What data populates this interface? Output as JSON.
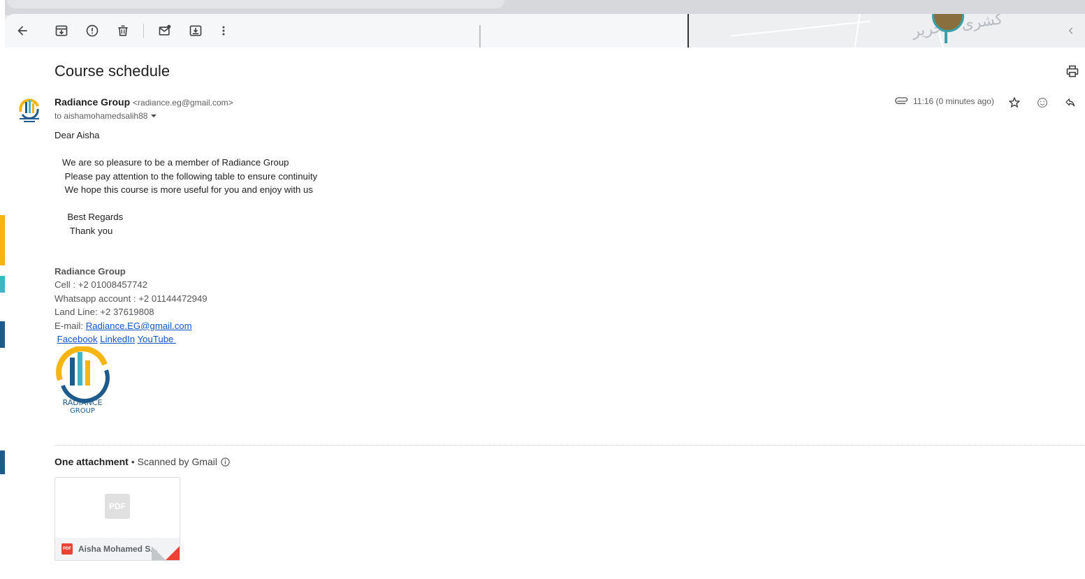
{
  "subject": "Course schedule",
  "sender": {
    "name": "Radiance Group",
    "email": "<radiance.eg@gmail.com>",
    "to": "to aishamohamedsalih88"
  },
  "meta": {
    "time": "11:16 (0 minutes ago)"
  },
  "body": {
    "greeting": "Dear Aisha",
    "line1": "   We are so pleasure to be a member of Radiance Group",
    "line2": "    Please pay attention to the following table to ensure continuity",
    "line3": "    We hope this course is more useful for you and enjoy with us",
    "closing1": "     Best Regards",
    "closing2": "      Thank you"
  },
  "signature": {
    "name": "Radiance Group",
    "cell": "Cell : +2 01008457742",
    "whatsapp": "Whatsapp account : +2 01144472949",
    "landline": "Land Line: +2 37619808",
    "email_label": "E-mail: ",
    "email_link": "Radiance.EG@gmail.com",
    "links": [
      "Facebook",
      "LinkedIn",
      "YouTube "
    ]
  },
  "logo_text": [
    "RADIANCE",
    "GROUP"
  ],
  "map_text": "كشرى التحرير",
  "attachments": {
    "title": "One attachment",
    "scanned": "• Scanned by Gmail",
    "file_name": "Aisha Mohamed S...",
    "thumb_label": "PDF",
    "type_label": "PDF"
  },
  "colors": {
    "link": "#1155cc",
    "pdf_red": "#ea4335",
    "logo_blue": "#1e5a8c",
    "logo_gold": "#f5b510"
  }
}
